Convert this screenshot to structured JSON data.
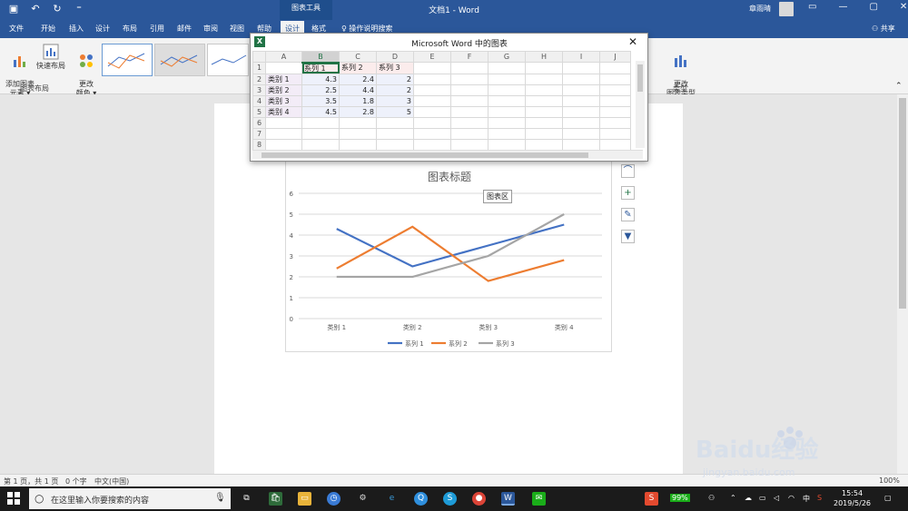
{
  "titlebar": {
    "context_tools": "图表工具",
    "doc_title": "文档1 - Word",
    "user": "章雨晴",
    "buttons": [
      "▭",
      "—",
      "▢",
      "✕"
    ]
  },
  "tabs": {
    "items": [
      "文件",
      "开始",
      "插入",
      "设计",
      "布局",
      "引用",
      "邮件",
      "审阅",
      "视图",
      "帮助",
      "设计",
      "格式"
    ],
    "active_index": 10,
    "tell_me": "操作说明搜索",
    "share": "共享"
  },
  "ribbon": {
    "add_element": "添加图表\n元素 ▾",
    "quick_layout": "快速布局",
    "change_colors": "更改\n颜色 ▾",
    "change_type": "更改\n图表类型",
    "group_layout": "图表布局",
    "group_type": "类型"
  },
  "excel": {
    "title": "Microsoft Word 中的图表",
    "columns": [
      "A",
      "B",
      "C",
      "D",
      "E",
      "F",
      "G",
      "H",
      "I",
      "J"
    ],
    "rows": [
      [
        "1",
        "",
        "系列 1",
        "系列 2",
        "系列 3",
        "",
        "",
        "",
        "",
        "",
        ""
      ],
      [
        "2",
        "类别 1",
        "4.3",
        "2.4",
        "2",
        "",
        "",
        "",
        "",
        "",
        ""
      ],
      [
        "3",
        "类别 2",
        "2.5",
        "4.4",
        "2",
        "",
        "",
        "",
        "",
        "",
        ""
      ],
      [
        "4",
        "类别 3",
        "3.5",
        "1.8",
        "3",
        "",
        "",
        "",
        "",
        "",
        ""
      ],
      [
        "5",
        "类别 4",
        "4.5",
        "2.8",
        "5",
        "",
        "",
        "",
        "",
        "",
        ""
      ],
      [
        "7",
        "",
        "",
        "",
        "",
        "",
        "",
        "",
        "",
        "",
        ""
      ],
      [
        "8",
        "",
        "",
        "",
        "",
        "",
        "",
        "",
        "",
        "",
        ""
      ]
    ],
    "row6_label": "6"
  },
  "chart_tooltip": "图表区",
  "chart_data": {
    "type": "line",
    "title": "图表标题",
    "categories": [
      "类别 1",
      "类别 2",
      "类别 3",
      "类别 4"
    ],
    "series": [
      {
        "name": "系列 1",
        "values": [
          4.3,
          2.5,
          3.5,
          4.5
        ],
        "color": "#4472c4"
      },
      {
        "name": "系列 2",
        "values": [
          2.4,
          4.4,
          1.8,
          2.8
        ],
        "color": "#ed7d31"
      },
      {
        "name": "系列 3",
        "values": [
          2,
          2,
          3,
          5
        ],
        "color": "#a5a5a5"
      }
    ],
    "ylim": [
      0,
      6
    ],
    "yticks": [
      "0",
      "1",
      "2",
      "3",
      "4",
      "5",
      "6"
    ],
    "grid": true,
    "legend": "bottom"
  },
  "statusbar": {
    "page": "第 1 页，共 1 页",
    "words": "0 个字",
    "lang": "中文(中国)",
    "zoom": "100%"
  },
  "taskbar": {
    "search_placeholder": "在这里输入你要搜索的内容",
    "battery": "99%",
    "ime": "中",
    "time": "15:54",
    "date": "2019/5/26"
  },
  "watermark": {
    "brand": "Baidu经验",
    "url": "jingyan.baidu.com"
  },
  "colors": {
    "word_blue": "#2b579a",
    "excel_green": "#217346"
  }
}
